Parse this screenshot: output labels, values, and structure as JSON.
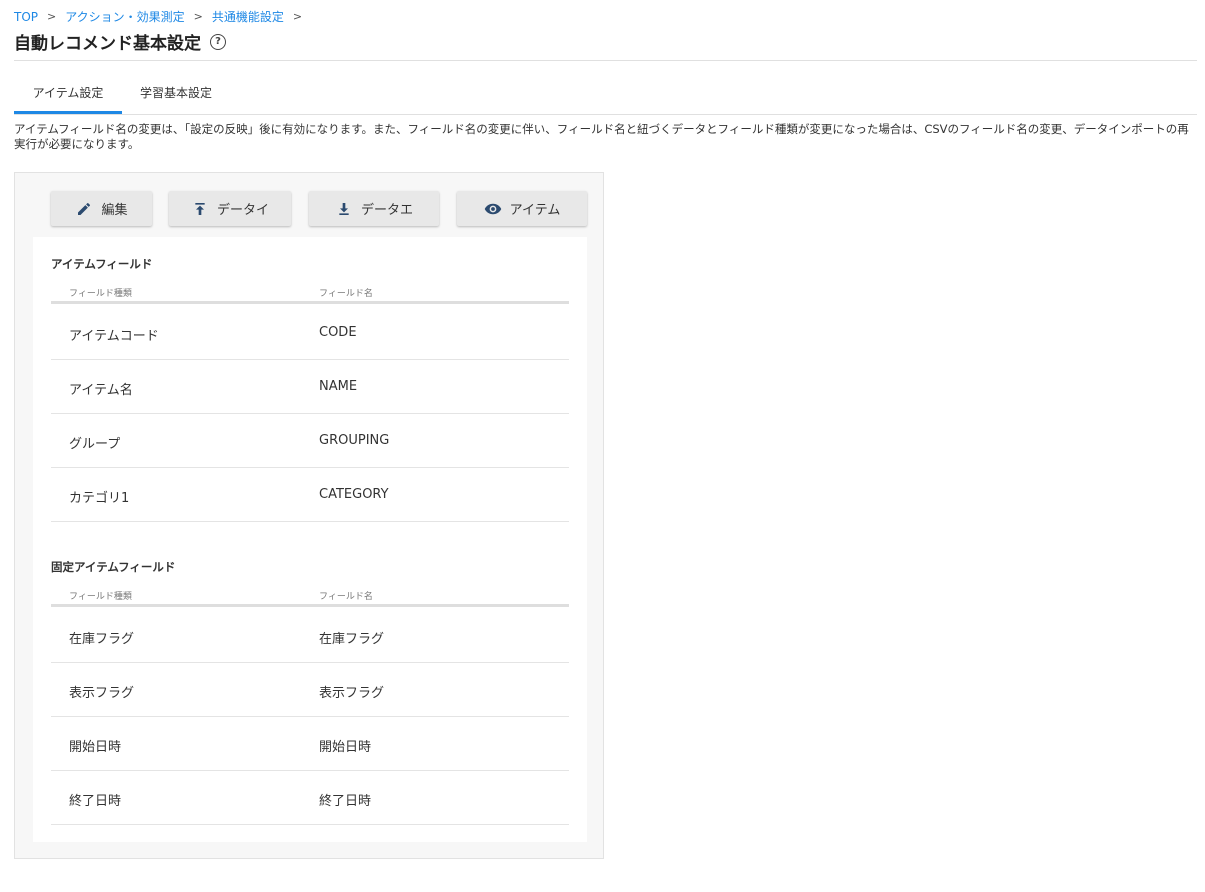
{
  "breadcrumb": {
    "items": [
      "TOP",
      "アクション・効果測定",
      "共通機能設定"
    ],
    "separator": ">"
  },
  "page": {
    "title": "自動レコメンド基本設定",
    "help_glyph": "?"
  },
  "tabs": [
    {
      "label": "アイテム設定",
      "active": true
    },
    {
      "label": "学習基本設定",
      "active": false
    }
  ],
  "notice": "アイテムフィールド名の変更は、「設定の反映」後に有効になります。また、フィールド名の変更に伴い、フィールド名と紐づくデータとフィールド種類が変更になった場合は、CSVのフィールド名の変更、データインポートの再実行が必要になります。",
  "toolbar": {
    "edit_label": "編集",
    "import_label": "データイ",
    "export_label": "データエ",
    "preview_label": "アイテム"
  },
  "item_fields": {
    "title": "アイテムフィールド",
    "col_type": "フィールド種類",
    "col_name": "フィールド名",
    "rows": [
      {
        "type": "アイテムコード",
        "name": "CODE"
      },
      {
        "type": "アイテム名",
        "name": "NAME"
      },
      {
        "type": "グループ",
        "name": "GROUPING"
      },
      {
        "type": "カテゴリ1",
        "name": "CATEGORY"
      }
    ]
  },
  "fixed_fields": {
    "title": "固定アイテムフィールド",
    "col_type": "フィールド種類",
    "col_name": "フィールド名",
    "rows": [
      {
        "type": "在庫フラグ",
        "name": "在庫フラグ"
      },
      {
        "type": "表示フラグ",
        "name": "表示フラグ"
      },
      {
        "type": "開始日時",
        "name": "開始日時"
      },
      {
        "type": "終了日時",
        "name": "終了日時"
      }
    ]
  },
  "colors": {
    "accent": "#1e88e5",
    "icon": "#2b4a6f"
  }
}
